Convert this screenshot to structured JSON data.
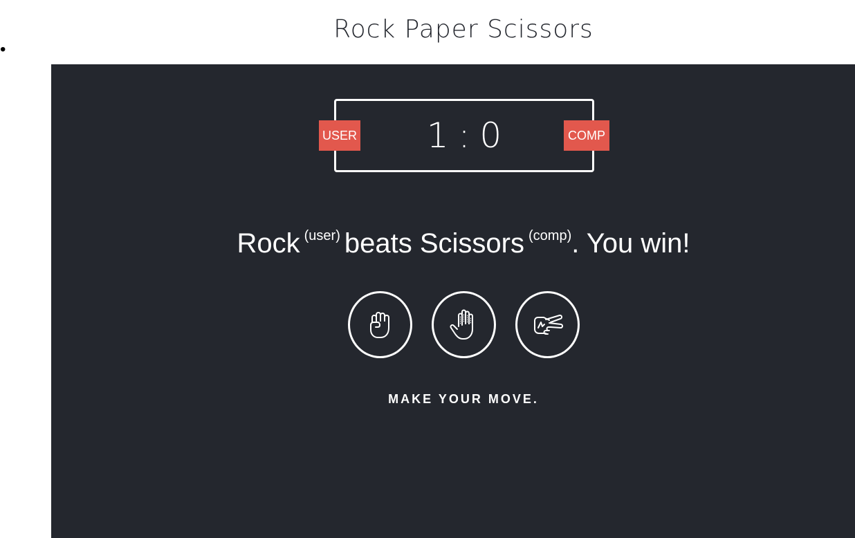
{
  "header": {
    "title": "Rock Paper Scissors",
    "bullet": "•"
  },
  "scoreboard": {
    "user_label": "USER",
    "comp_label": "COMP",
    "user_score": "1",
    "separator": ":",
    "comp_score": "0"
  },
  "result": {
    "user_move": "Rock",
    "user_tag": "(user)",
    "verb": "beats",
    "comp_move": "Scissors",
    "comp_tag": "(comp)",
    "outcome": ". You win!"
  },
  "choices": [
    {
      "name": "rock",
      "icon": "fist-icon"
    },
    {
      "name": "paper",
      "icon": "open-hand-icon"
    },
    {
      "name": "scissors",
      "icon": "scissors-hand-icon"
    }
  ],
  "action_message": "MAKE YOUR MOVE.",
  "colors": {
    "background": "#24272e",
    "badge": "#e2584d",
    "text": "#ffffff"
  }
}
